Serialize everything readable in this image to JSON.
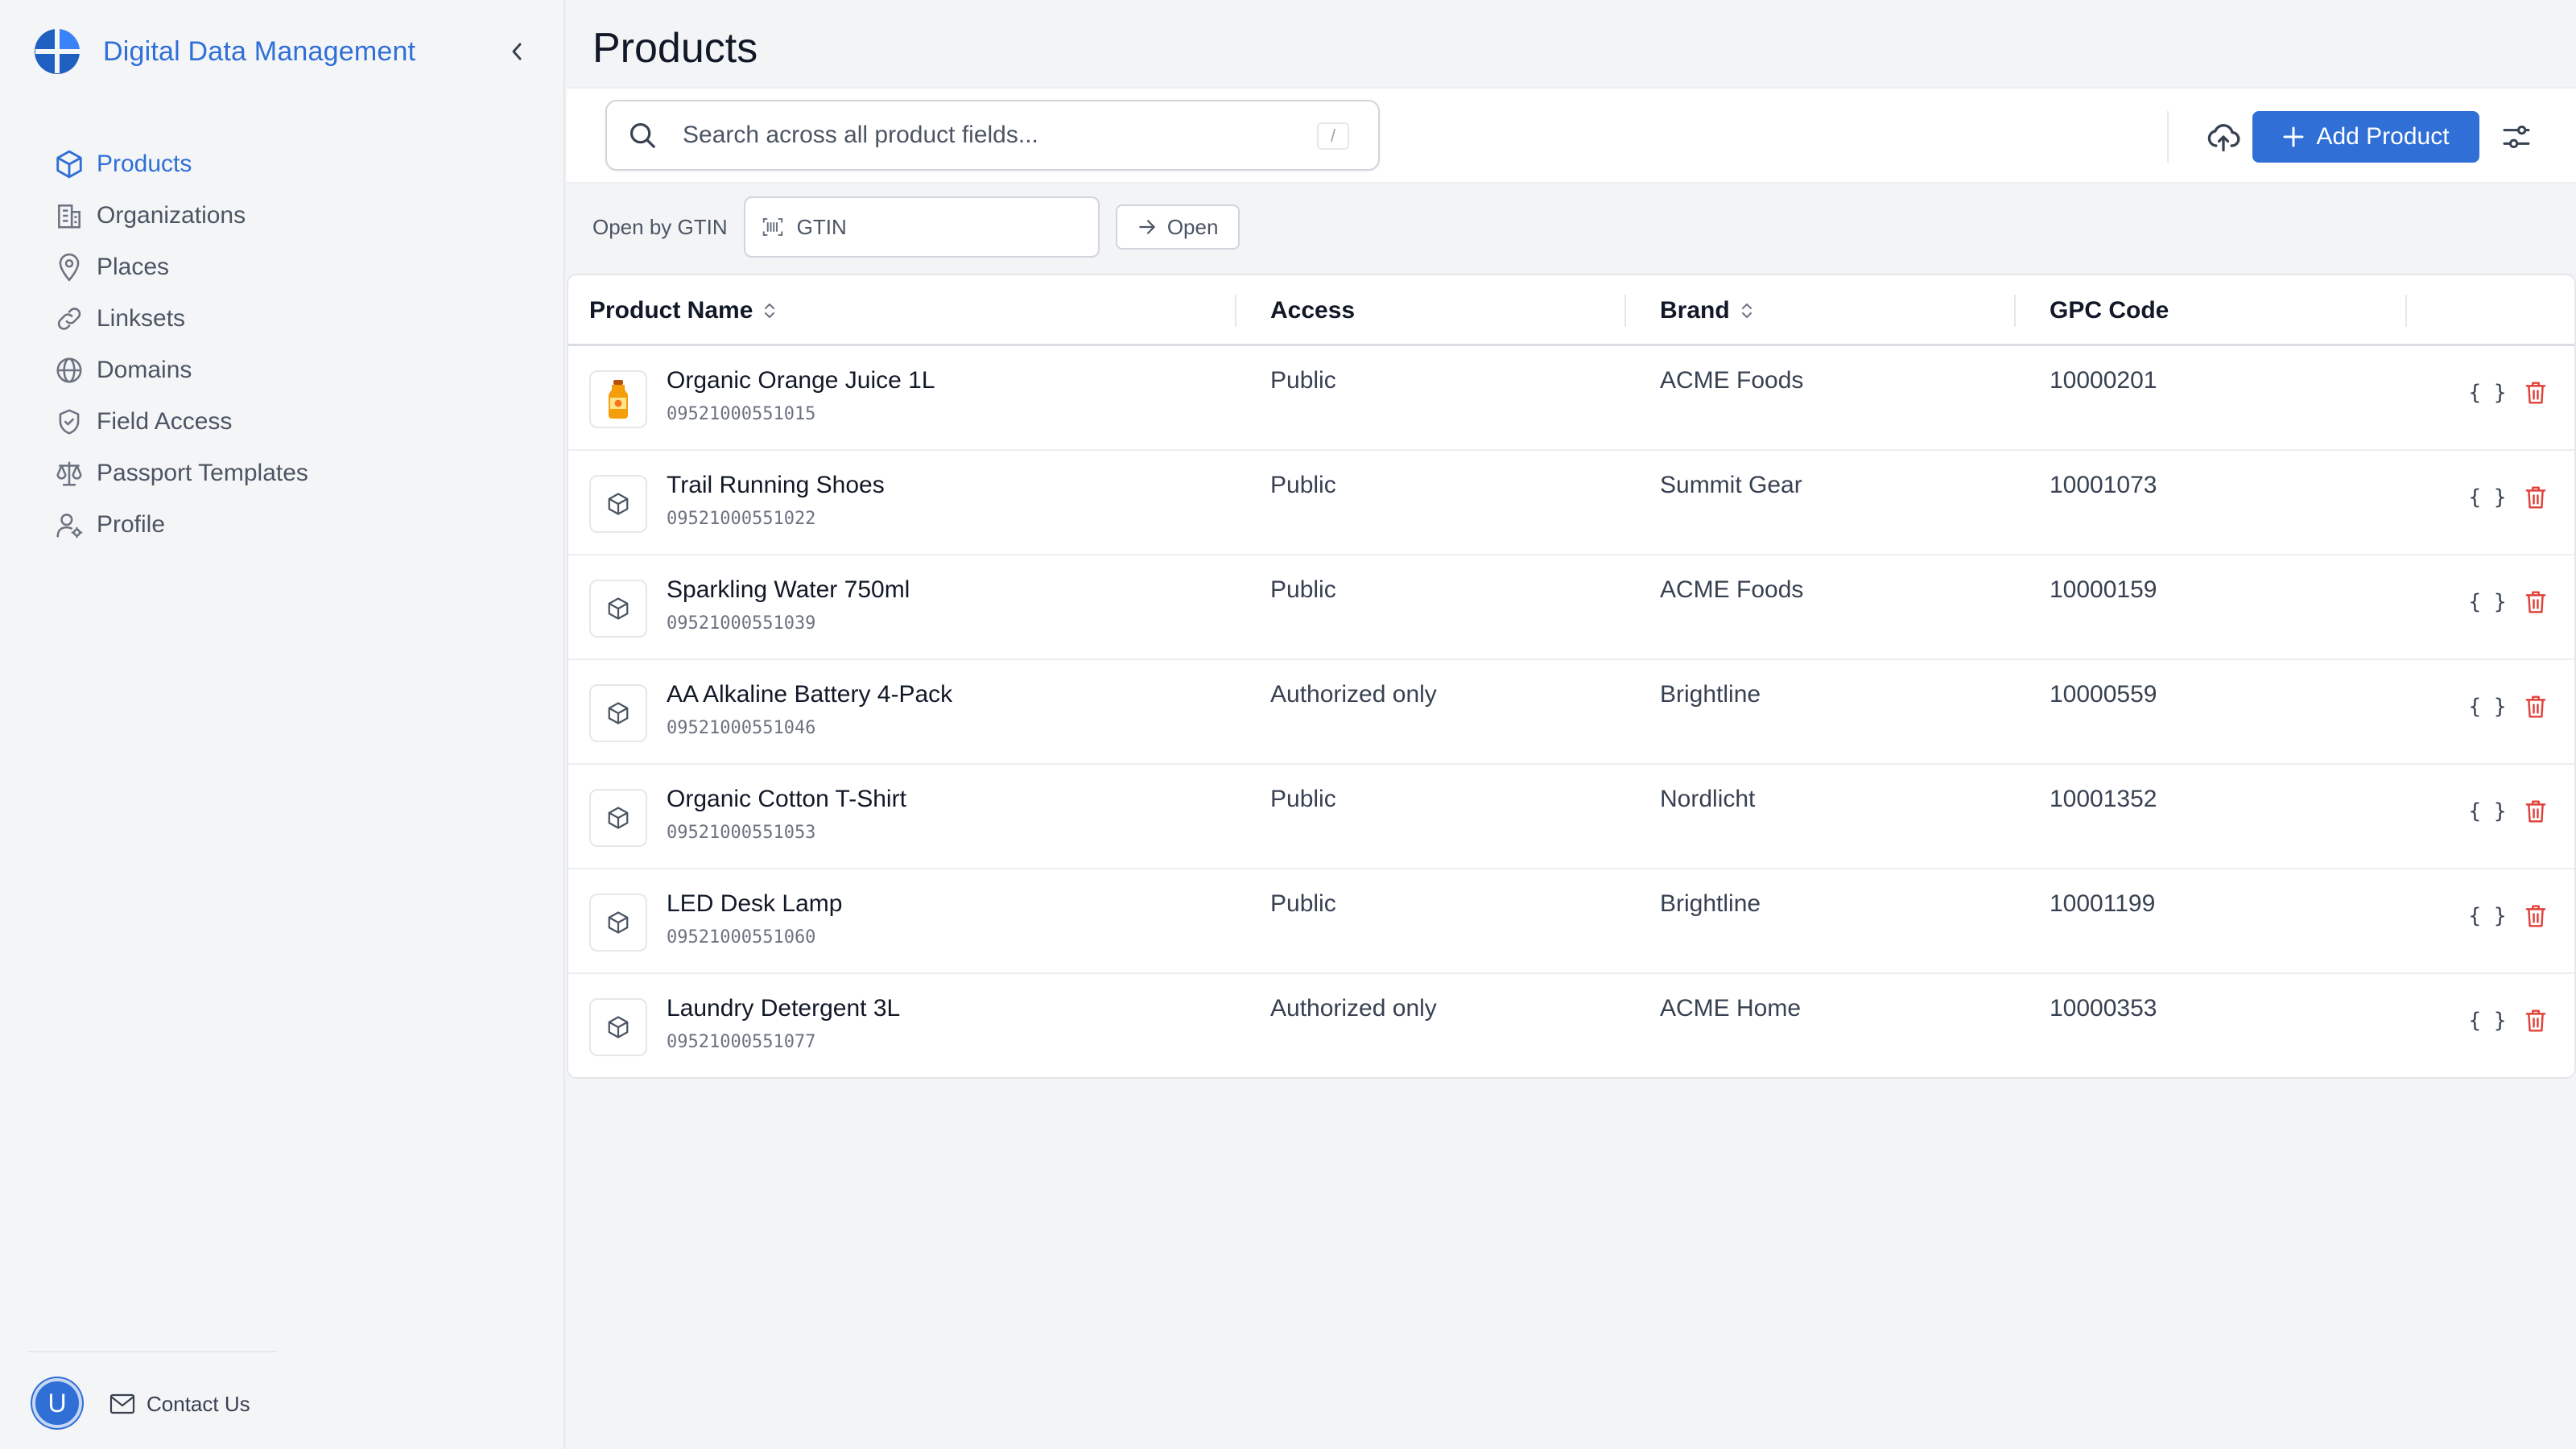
{
  "app": {
    "title": "Digital Data Management"
  },
  "sidebar": {
    "items": [
      {
        "label": "Products",
        "icon": "cube-icon",
        "active": true
      },
      {
        "label": "Organizations",
        "icon": "building-icon"
      },
      {
        "label": "Places",
        "icon": "map-pin-icon"
      },
      {
        "label": "Linksets",
        "icon": "link-icon"
      },
      {
        "label": "Domains",
        "icon": "globe-icon"
      },
      {
        "label": "Field Access",
        "icon": "shield-check-icon"
      },
      {
        "label": "Passport Templates",
        "icon": "scale-icon"
      },
      {
        "label": "Profile",
        "icon": "user-gear-icon"
      }
    ],
    "user_initial": "U",
    "contact_label": "Contact Us"
  },
  "page": {
    "title": "Products"
  },
  "toolbar": {
    "search_placeholder": "Search across all product fields...",
    "search_shortcut": "/",
    "add_label": "Add Product"
  },
  "gtin": {
    "label": "Open by GTIN",
    "placeholder": "GTIN",
    "open_label": "Open"
  },
  "table": {
    "columns": [
      "Product Name",
      "Access",
      "Brand",
      "GPC Code"
    ],
    "rows": [
      {
        "name": "Organic Orange Juice 1L",
        "gtin": "09521000551015",
        "access": "Public",
        "brand": "ACME Foods",
        "gpc": "10000201",
        "thumb": "juice-bottle-icon"
      },
      {
        "name": "Trail Running Shoes",
        "gtin": "09521000551022",
        "access": "Public",
        "brand": "Summit Gear",
        "gpc": "10001073",
        "thumb": "cube-icon"
      },
      {
        "name": "Sparkling Water 750ml",
        "gtin": "09521000551039",
        "access": "Public",
        "brand": "ACME Foods",
        "gpc": "10000159",
        "thumb": "cube-icon"
      },
      {
        "name": "AA Alkaline Battery 4-Pack",
        "gtin": "09521000551046",
        "access": "Authorized only",
        "brand": "Brightline",
        "gpc": "10000559",
        "thumb": "cube-icon"
      },
      {
        "name": "Organic Cotton T-Shirt",
        "gtin": "09521000551053",
        "access": "Public",
        "brand": "Nordlicht",
        "gpc": "10001352",
        "thumb": "cube-icon"
      },
      {
        "name": "LED Desk Lamp",
        "gtin": "09521000551060",
        "access": "Public",
        "brand": "Brightline",
        "gpc": "10001199",
        "thumb": "cube-icon"
      },
      {
        "name": "Laundry Detergent 3L",
        "gtin": "09521000551077",
        "access": "Authorized only",
        "brand": "ACME Home",
        "gpc": "10000353",
        "thumb": "cube-icon"
      }
    ],
    "json_action_label": "{ }"
  },
  "colors": {
    "accent": "#2f6fd6",
    "danger": "#e0413a",
    "text": "#111827"
  }
}
